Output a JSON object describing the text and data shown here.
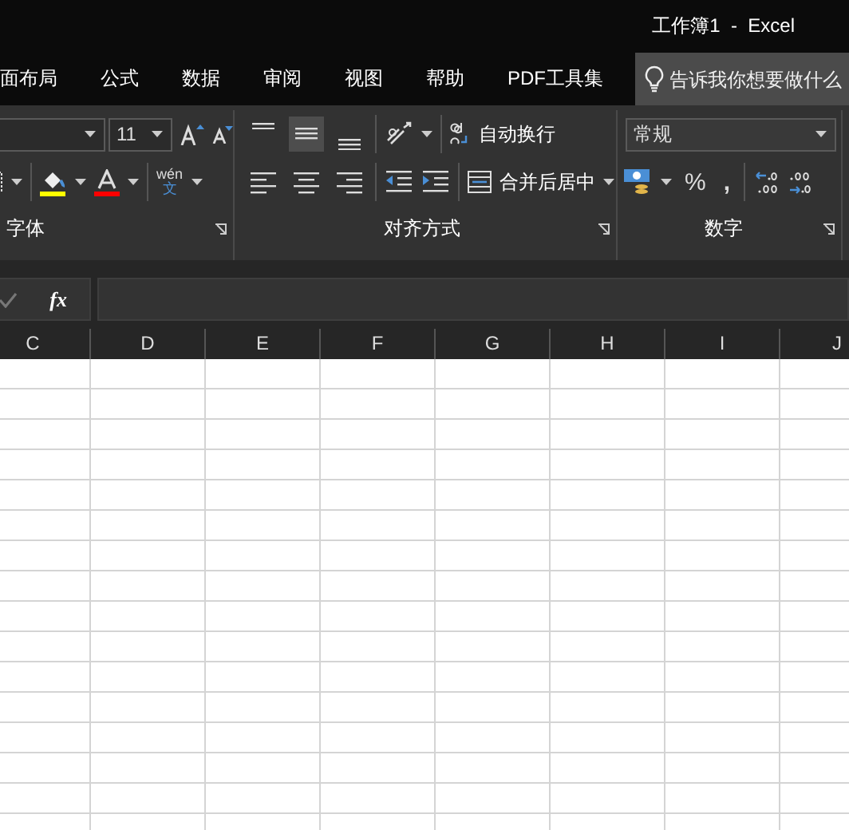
{
  "window": {
    "title": "工作簿1  -  Excel"
  },
  "tabs": [
    {
      "label": "面布局",
      "selected": false
    },
    {
      "label": "公式",
      "selected": false
    },
    {
      "label": "数据",
      "selected": false
    },
    {
      "label": "审阅",
      "selected": false
    },
    {
      "label": "视图",
      "selected": false
    },
    {
      "label": "帮助",
      "selected": false
    },
    {
      "label": "PDF工具集",
      "selected": false
    }
  ],
  "tell_me": {
    "placeholder": "告诉我你想要做什么"
  },
  "ribbon": {
    "font": {
      "label": "字体",
      "font_size": "11",
      "phonetic_reading": "wén",
      "phonetic_glyph": "文"
    },
    "alignment": {
      "label": "对齐方式",
      "vertical": [
        {
          "kind": "top",
          "selected": false
        },
        {
          "kind": "middle",
          "selected": true
        },
        {
          "kind": "bottom",
          "selected": false
        }
      ],
      "horizontal": [
        {
          "kind": "left",
          "selected": false
        },
        {
          "kind": "center",
          "selected": false
        },
        {
          "kind": "right",
          "selected": false
        }
      ],
      "wrap_text": "自动换行",
      "merge": "合并后居中"
    },
    "number": {
      "label": "数字",
      "format": "常规",
      "percent": "%",
      "comma": ","
    }
  },
  "formula_bar": {
    "function_label": "fx"
  },
  "columns": [
    "C",
    "D",
    "E",
    "F",
    "G",
    "H",
    "I",
    "J"
  ]
}
